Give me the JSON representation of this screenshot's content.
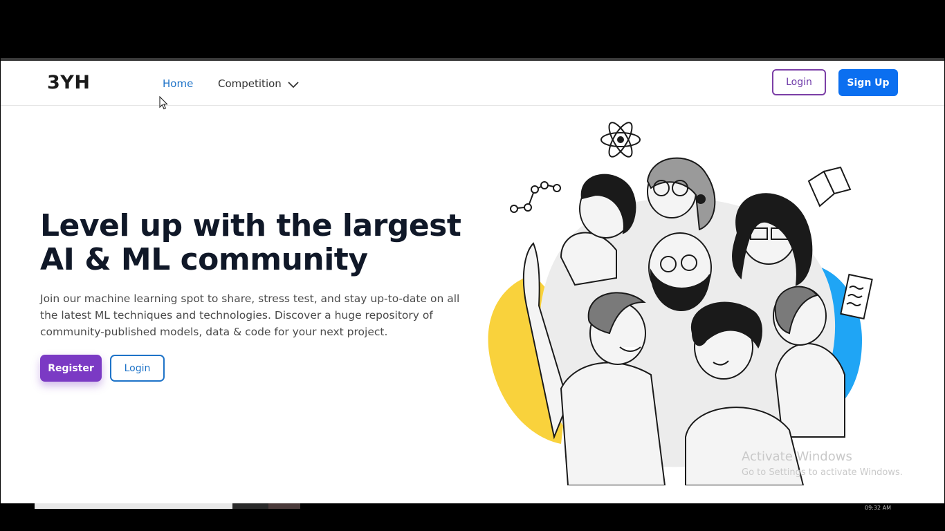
{
  "navbar": {
    "logo": "3YH",
    "links": {
      "home": "Home",
      "competition": "Competition"
    },
    "login": "Login",
    "signup": "Sign Up"
  },
  "hero": {
    "title_line1": "Level up with the largest",
    "title_line2": "AI & ML community",
    "description": "Join our machine learning spot to share, stress test, and stay up-to-date on all the latest ML techniques and technologies. Discover a huge repository of community-published models, data & code for your next project.",
    "register": "Register",
    "login": "Login"
  },
  "watermark": {
    "title": "Activate Windows",
    "subtitle": "Go to Settings to activate Windows."
  },
  "taskbar": {
    "time": "09:32 AM"
  },
  "colors": {
    "accent_blue": "#0b6ff0",
    "accent_purple": "#7b3ac4",
    "link_blue": "#1e73c8",
    "blob_yellow": "#f9d23c",
    "blob_blue": "#1fa5f5"
  }
}
